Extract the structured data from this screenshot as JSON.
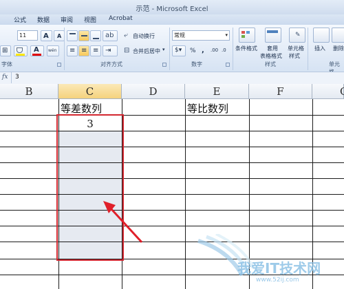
{
  "window": {
    "title": "示范 - Microsoft Excel"
  },
  "ribbon_tabs": [
    "公式",
    "数据",
    "审阅",
    "视图",
    "Acrobat"
  ],
  "ribbon": {
    "font_size": "11",
    "grow_font": "A",
    "shrink_font": "A",
    "font_color_label": "A",
    "phonetic_label": "wén",
    "wrap_text": "自动换行",
    "merge_center": "合并后居中",
    "number_format": "常规",
    "percent": "%",
    "comma": ",",
    "inc_decimal": ".00",
    "dec_decimal": ".0",
    "conditional_format": "条件格式",
    "table_format_1": "套用",
    "table_format_2": "表格格式",
    "cell_style_1": "单元格",
    "cell_style_2": "样式",
    "insert": "插入",
    "delete": "删除",
    "groups": {
      "font": "字体",
      "alignment": "对齐方式",
      "number": "数字",
      "styles": "样式",
      "cells": "单元格"
    }
  },
  "formula_bar": {
    "fx": "fx",
    "value": "3"
  },
  "columns": [
    "B",
    "C",
    "D",
    "E",
    "F",
    "G"
  ],
  "cells": {
    "c_header": "等差数列",
    "e_header": "等比数列",
    "c_value": "3"
  },
  "watermark": {
    "text": "我爱IT技术网",
    "url": "www.52ij.com"
  },
  "colors": {
    "selection_border": "#d2262f",
    "arrow": "#e0202a",
    "selected_header": "#f5d27d"
  }
}
